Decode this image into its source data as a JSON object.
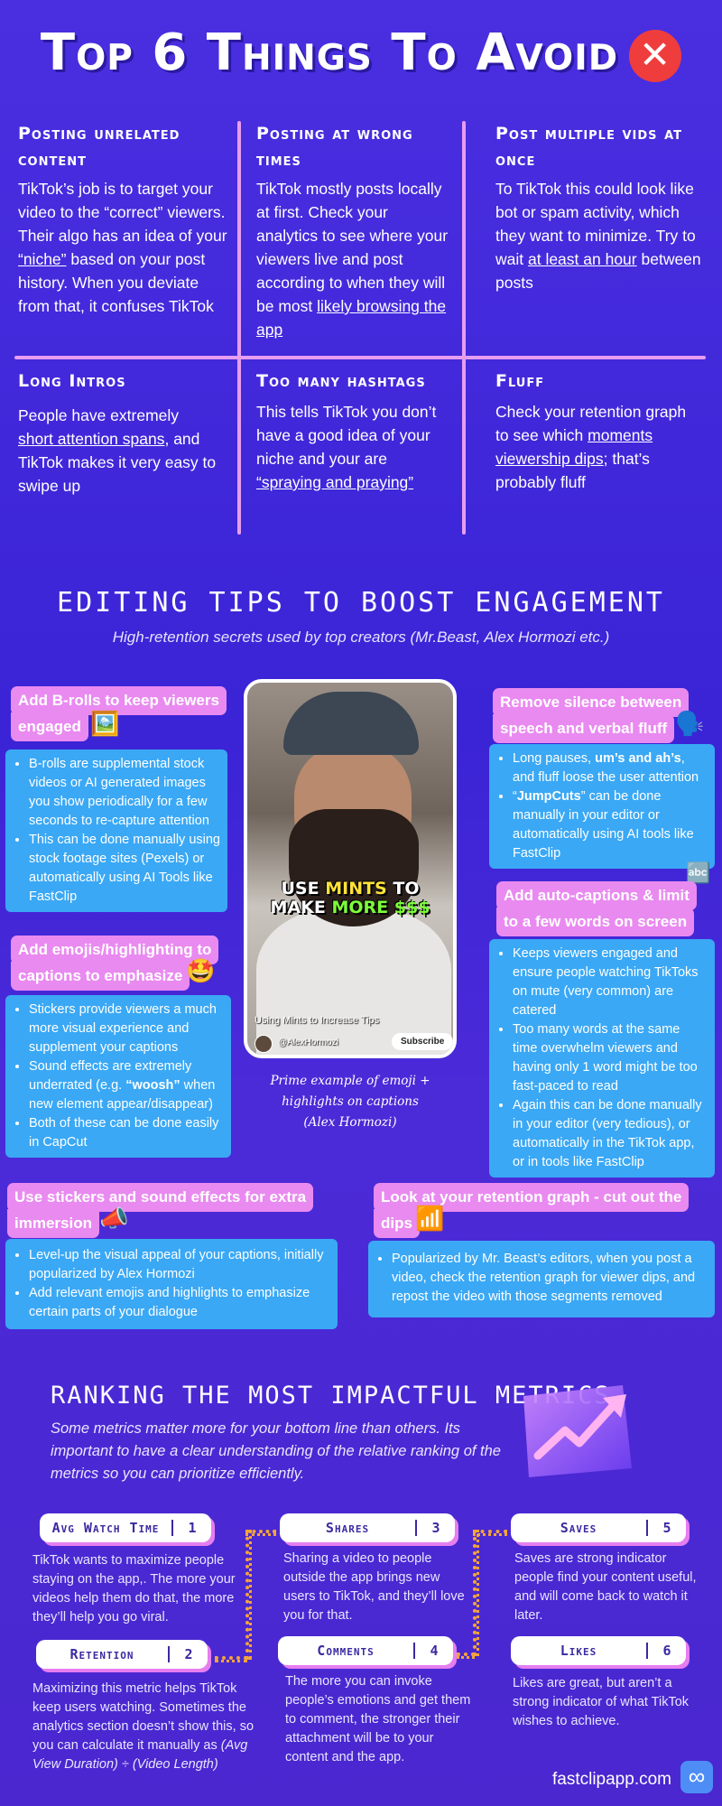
{
  "header": {
    "title": "Top 6 Things To Avoid",
    "x_icon": "close-circle-icon"
  },
  "avoid": [
    {
      "title": "Posting unrelated content",
      "text_a": "TikTok’s job is to target your video to the “correct” viewers. Their algo has an idea of your ",
      "link": "“niche”",
      "text_b": " based on your post history. When you deviate from that, it confuses TikTok"
    },
    {
      "title": "Posting at wrong times",
      "text_a": "TikTok mostly posts locally at first. Check your analytics to see where your viewers live and post according to when they will be most ",
      "link": "likely browsing the app",
      "text_b": ""
    },
    {
      "title": "Post multiple vids at once",
      "text_a": "To TikTok this could look like bot or spam activity, which they want to minimize. Try to wait ",
      "link": "at least an hour",
      "text_b": " between posts"
    },
    {
      "title": "Long Intros",
      "text_a": "People have extremely ",
      "link": "short attention spans",
      "text_b": ", and TikTok makes it very easy to swipe up"
    },
    {
      "title": "Too many hashtags",
      "text_a": "This tells TikTok you don’t have a good idea of your niche and your are ",
      "link": "“spraying and praying”",
      "text_b": ""
    },
    {
      "title": "Fluff",
      "text_a": "Check your retention graph to see which ",
      "link": "moments viewership dips",
      "text_b": "; that’s probably fluff"
    }
  ],
  "tips": {
    "title": "EDITING TIPS TO BOOST ENGAGEMENT",
    "subtitle": "High-retention secrets used by top creators (Mr.Beast, Alex Hormozi etc.)",
    "broll": {
      "pill1": "Add B-rolls to keep viewers",
      "pill2": "engaged",
      "b1": "B-rolls are supplemental stock videos or AI generated images you show periodically for a few seconds to re-capture attention",
      "b2": "This can be done manually using stock footage sites (Pexels) or automatically using AI Tools like FastClip"
    },
    "emojis": {
      "pill1": "Add emojis/highlighting to",
      "pill2": "captions to emphasize",
      "b1": "Stickers provide viewers a much more visual experience and supplement your captions",
      "b2a": "Sound effects are extremely underrated (e.g. ",
      "b2b": "“woosh”",
      "b2c": " when new element appear/disappear)",
      "b3": "Both of these can be done easily in CapCut"
    },
    "silence": {
      "pill1": "Remove silence between",
      "pill2": "speech and verbal fluff",
      "b1a": "Long pauses, ",
      "b1b": "um’s and ah’s",
      "b1c": ", and fluff loose the user attention",
      "b2a": "“",
      "b2b": "JumpCuts",
      "b2c": "” can be done manually in your editor or automatically using AI tools like FastClip"
    },
    "captions": {
      "pill1": "Add auto-captions & limit",
      "pill2": "to a few words on screen",
      "b1": "Keeps viewers engaged and ensure people watching TikToks on mute (very common) are catered",
      "b2": "Too many words at the same time overwhelm viewers and having only 1 word might be too fast-paced to read",
      "b3": "Again this can be done manually in your editor (very tedious), or automatically in the TikTok app, or in tools like FastClip"
    },
    "stickers": {
      "pill1": "Use stickers and sound effects for extra",
      "pill2": "immersion",
      "b1": "Level-up the visual appeal of your captions, initially popularized by Alex Hormozi",
      "b2": "Add relevant emojis and highlights to emphasize certain parts of your dialogue"
    },
    "retention": {
      "pill1": "Look at your retention graph - cut out  the",
      "pill2": "dips",
      "b1": "Popularized by Mr. Beast’s editors, when you post a video, check the retention graph for viewer dips, and repost the video with those segments removed"
    },
    "phone": {
      "overlay_1a": "USE ",
      "overlay_1b": "MINTS",
      "overlay_1c": " TO",
      "overlay_2a": "MAKE ",
      "overlay_2b": "MORE $$$",
      "video_title": "Using Mints to Increase Tips",
      "handle": "@AlexHormozi",
      "subscribe": "Subscribe"
    },
    "phone_caption_1": "Prime example of emoji +",
    "phone_caption_2": "highlights on captions",
    "phone_caption_3": "(Alex Hormozi)"
  },
  "metrics": {
    "title": "RANKING THE MOST IMPACTFUL METRICS",
    "description": "Some metrics matter more for your bottom line than others. Its important to have a clear understanding of the relative ranking of the metrics so you can prioritize efficiently.",
    "items": [
      {
        "name": "Avg Watch Time",
        "rank": "1",
        "text": "TikTok wants to maximize people staying on the app,. The more your videos help them do that, the more they’ll help you go viral."
      },
      {
        "name": "Retention",
        "rank": "2",
        "text": "Maximizing this metric helps TikTok keep users watching. Sometimes the analytics section doesn’t show this, so you can calculate it manually as",
        "formula": "(Avg View Duration) ÷ (Video Length)"
      },
      {
        "name": "Shares",
        "rank": "3",
        "text": "Sharing a video to people outside the app brings new users to TikTok, and they’ll love you for that."
      },
      {
        "name": "Comments",
        "rank": "4",
        "text": "The more you can invoke people’s emotions and get them to comment, the stronger their attachment will be to your content and the app."
      },
      {
        "name": "Saves",
        "rank": "5",
        "text": "Saves are strong indicator people find your content useful, and will come back to watch it later."
      },
      {
        "name": "Likes",
        "rank": "6",
        "text": "Likes are great, but aren’t a strong indicator of what TikTok wishes to achieve."
      }
    ]
  },
  "footer": {
    "url": "fastclipapp.com",
    "logo": "∞"
  },
  "colors": {
    "pink_accent": "#e79ef0",
    "pill": "#e98af0",
    "blue_box": "#3aa8f5",
    "x_red": "#ef3d3d"
  }
}
